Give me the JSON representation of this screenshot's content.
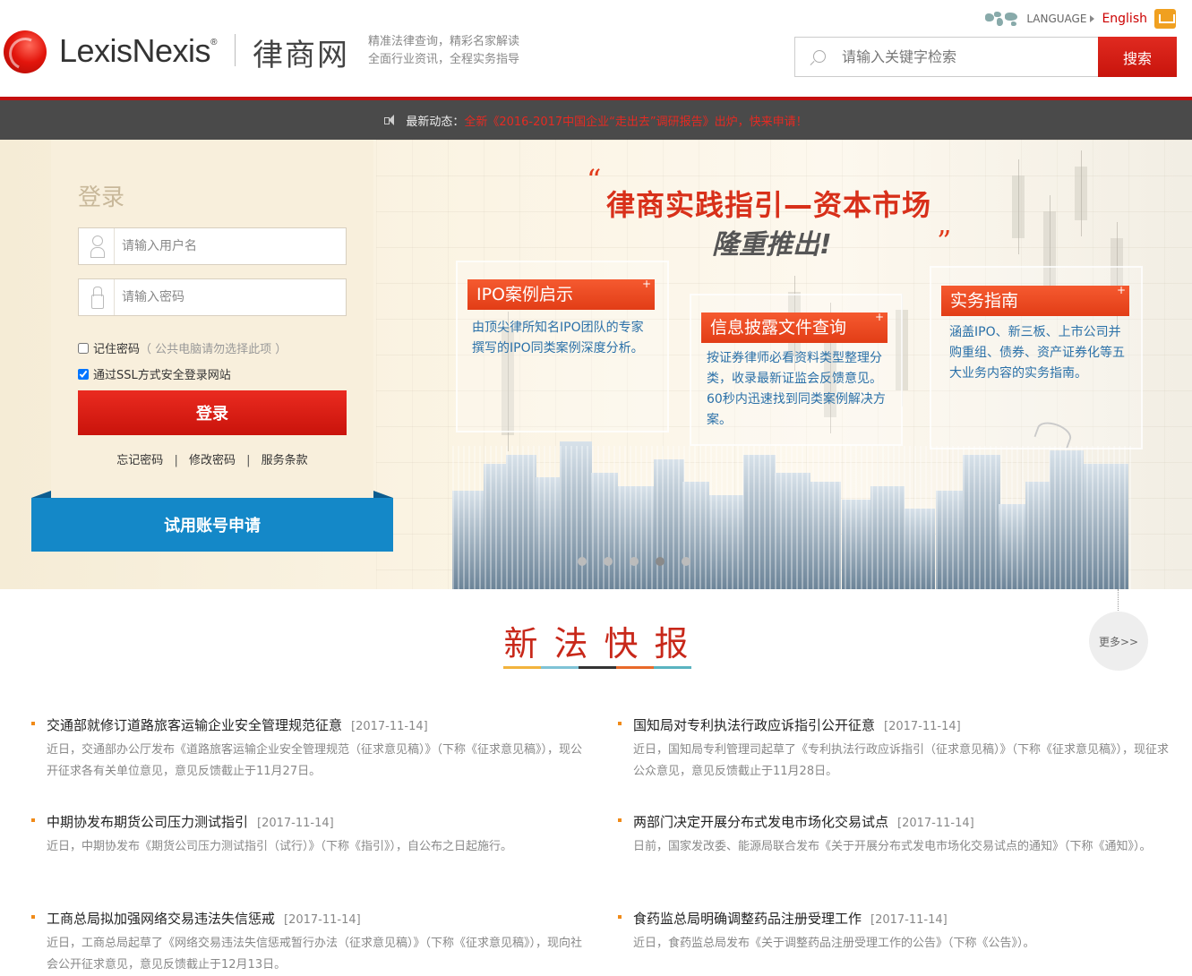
{
  "brand": {
    "name": "LexisNexis",
    "registered_mark": "®",
    "cn_name": "律商网",
    "slogan_1": "精准法律查询，精彩名家解读",
    "slogan_2": "全面行业资讯，全程实务指导"
  },
  "language": {
    "label": "LANGUAGE",
    "english_link": "English"
  },
  "search": {
    "placeholder": "请输入关键字检索",
    "button_label": "搜索"
  },
  "announcement": {
    "label": "最新动态：",
    "link_text": "全新《2016-2017中国企业“走出去”调研报告》出炉，快来申请！"
  },
  "login": {
    "title": "登录",
    "username_placeholder": "请输入用户名",
    "password_placeholder": "请输入密码",
    "remember_label": "记住密码",
    "remember_hint": "（ 公共电脑请勿选择此项 ）",
    "ssl_label": "通过SSL方式安全登录网站",
    "submit_label": "登录",
    "links": [
      "忘记密码",
      "修改密码",
      "服务条款"
    ],
    "separator": "|",
    "trial_label": "试用账号申请"
  },
  "banner": {
    "quote_open": "“",
    "quote_close": "”",
    "title": "律商实践指引—资本市场",
    "subtitle": "隆重推出!",
    "cards": [
      {
        "tag": "IPO案例启示",
        "text": "由顶尖律所知名IPO团队的专家撰写的IPO同类案例深度分析。"
      },
      {
        "tag": "信息披露文件查询",
        "text": "按证券律师必看资料类型整理分类，收录最新证监会反馈意见。60秒内迅速找到同类案例解决方案。"
      },
      {
        "tag": "实务指南",
        "text": "涵盖IPO、新三板、上市公司并购重组、债券、资产证券化等五大业务内容的实务指南。"
      }
    ],
    "slide_count": 5,
    "active_slide": 4
  },
  "news_section": {
    "title": "新法快报",
    "more_label": "更多>>",
    "underline_colors": [
      "#f2b33d",
      "#7fc3d6",
      "#333333",
      "#e8692a",
      "#5ab3c0"
    ],
    "items": [
      {
        "headline": "交通部就修订道路旅客运输企业安全管理规范征意",
        "date": "[2017-11-14]",
        "summary": "近日，交通部办公厅发布《道路旅客运输企业安全管理规范（征求意见稿）》（下称《征求意见稿》），现公开征求各有关单位意见，意见反馈截止于11月27日。"
      },
      {
        "headline": "国知局对专利执法行政应诉指引公开征意",
        "date": "[2017-11-14]",
        "summary": "近日，国知局专利管理司起草了《专利执法行政应诉指引（征求意见稿）》（下称《征求意见稿》），现征求公众意见，意见反馈截止于11月28日。"
      },
      {
        "headline": "中期协发布期货公司压力测试指引",
        "date": "[2017-11-14]",
        "summary": "近日，中期协发布《期货公司压力测试指引（试行）》（下称《指引》），自公布之日起施行。"
      },
      {
        "headline": "两部门决定开展分布式发电市场化交易试点",
        "date": "[2017-11-14]",
        "summary": "日前，国家发改委、能源局联合发布《关于开展分布式发电市场化交易试点的通知》（下称《通知》）。"
      },
      {
        "headline": "工商总局拟加强网络交易违法失信惩戒",
        "date": "[2017-11-14]",
        "summary": "近日，工商总局起草了《网络交易违法失信惩戒暂行办法（征求意见稿）》（下称《征求意见稿》），现向社会公开征求意见，意见反馈截止于12月13日。"
      },
      {
        "headline": "食药监总局明确调整药品注册受理工作",
        "date": "[2017-11-14]",
        "summary": "近日，食药监总局发布《关于调整药品注册受理工作的公告》（下称《公告》）。"
      }
    ]
  },
  "colors": {
    "brand_red": "#c40f0f",
    "accent_blue": "#1488c8",
    "card_text_blue": "#2a70a8"
  }
}
